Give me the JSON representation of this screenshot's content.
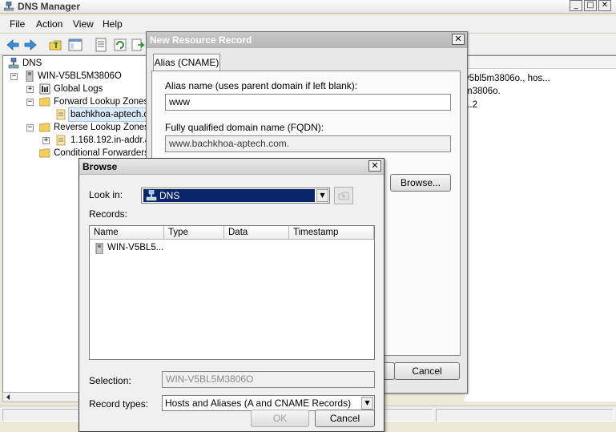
{
  "main": {
    "title": "DNS Manager",
    "controls": {
      "minimize": "_",
      "maximize": "□",
      "close": "✕"
    },
    "menu": [
      "File",
      "Action",
      "View",
      "Help"
    ],
    "tree": {
      "root": "DNS",
      "server": "WIN-V5BL5M3806O",
      "global_logs": "Global Logs",
      "forward_zones": "Forward Lookup Zones",
      "forward_zone_item": "bachkhoa-aptech.co",
      "reverse_zones": "Reverse Lookup Zones",
      "reverse_zone_item": "1.168.192.in-addr.a",
      "conditional_forwarders": "Conditional Forwarders",
      "expand": "+",
      "collapse": "−"
    },
    "right_pane": {
      "line1": "v5bl5m3806o., hos...",
      "line2": "m3806o.",
      "line3": "1.2"
    }
  },
  "new_record_dialog": {
    "title": "New Resource Record",
    "close": "✕",
    "tab": "Alias (CNAME)",
    "alias_label": "Alias name (uses parent domain if left blank):",
    "alias_value": "www",
    "fqdn_label": "Fully qualified domain name (FQDN):",
    "fqdn_value": "www.bachkhoa-aptech.com.",
    "browse_button": "Browse...",
    "cancel_button": "Cancel"
  },
  "browse_dialog": {
    "title": "Browse",
    "close": "✕",
    "look_in_label": "Look in:",
    "look_in_value": "DNS",
    "records_label": "Records:",
    "columns": [
      "Name",
      "Type",
      "Data",
      "Timestamp"
    ],
    "records": [
      {
        "name": "WIN-V5BL5..."
      }
    ],
    "selection_label": "Selection:",
    "selection_value": "WIN-V5BL5M3806O",
    "record_types_label": "Record types:",
    "record_types_value": "Hosts and Aliases (A and CNAME Records)",
    "ok_button": "OK",
    "cancel_button": "Cancel"
  },
  "icons": [
    "dns-icon",
    "server-icon",
    "folder-icon",
    "zone-icon",
    "log-icon",
    "back-icon",
    "forward-icon",
    "up-folder-icon",
    "refresh-icon",
    "export-icon"
  ]
}
